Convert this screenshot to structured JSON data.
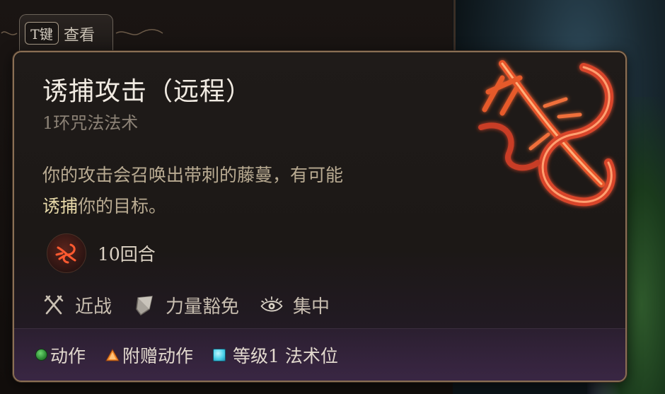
{
  "hint": {
    "key": "T键",
    "label": "查看"
  },
  "spell": {
    "title": "诱捕攻击（远程）",
    "subtitle": "1环咒法法术",
    "description_keyword": "诱捕",
    "description_before": "你的攻击会召唤出带刺的藤蔓，有可能",
    "description_after": "你的目标。"
  },
  "duration": {
    "text": "10回合",
    "icon": "ensnaring-vine-icon"
  },
  "properties": [
    {
      "label": "近战",
      "icon": "crossed-swords-icon"
    },
    {
      "label": "力量豁免",
      "icon": "strength-save-shield-icon"
    },
    {
      "label": "集中",
      "icon": "concentration-eye-icon"
    }
  ],
  "costs": [
    {
      "label": "动作",
      "icon": "action-green-dot",
      "color": "#3fae44"
    },
    {
      "label": "附赠动作",
      "icon": "bonus-action-orange-triangle",
      "color": "#f08a2a"
    },
    {
      "label": "等级1 法术位",
      "icon": "spell-slot-cyan-square",
      "color": "#4cd2ea"
    }
  ]
}
